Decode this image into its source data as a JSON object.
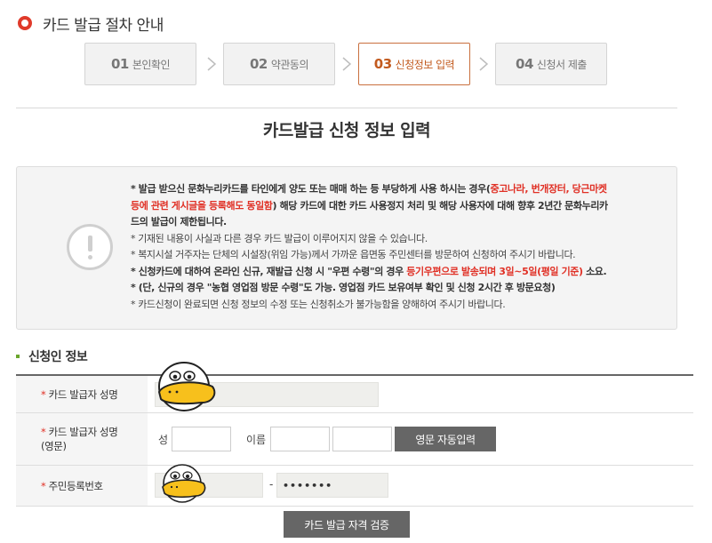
{
  "heading": {
    "title": "카드 발급 절차 안내"
  },
  "steps": [
    {
      "num": "01",
      "label": "본인확인",
      "active": false
    },
    {
      "num": "02",
      "label": "약관동의",
      "active": false
    },
    {
      "num": "03",
      "label": "신청정보 입력",
      "active": true
    },
    {
      "num": "04",
      "label": "신청서 제출",
      "active": false
    }
  ],
  "page_title": "카드발급 신청 정보 입력",
  "notice": {
    "line1a": "* 발급 받으신 문화누리카드를 타인에게 양도 또는 매매 하는 등 부당하게 사용 하시는 경우(",
    "line1b": "중고나라, 번개장터, 당근마켓",
    "line2a": "등에 관련 게시글을 등록해도 동일함",
    "line2b": ") 해당 카드에 대한 카드 사용정지 처리 및 해당 사용자에 대해 향후 2년간 문화누리카",
    "line3": "드의 발급이 제한됩니다.",
    "line4": "* 기재된 내용이 사실과 다른 경우 카드 발급이 이루어지지 않을 수 있습니다.",
    "line5": "* 복지시설 거주자는 단체의 시설장(위임 가능)께서 가까운 읍면동 주민센터를 방문하여 신청하여 주시기 바랍니다.",
    "line6a": "* 신청카드에 대하여 온라인 신규, 재발급 신청 시 \"우편 수령\"의 경우 ",
    "line6b": "등기우편으로 발송되며 3일~5일(평일 기준)",
    "line6c": " 소요.",
    "line7": "* (단, 신규의 경우 \"농협 영업점 방문 수령\"도 가능. 영업점 카드 보유여부 확인 및 신청 2시간 후 방문요청)",
    "line8": "* 카드신청이 완료되면 신청 정보의 수정 또는 신청취소가 불가능함을 양해하여 주시기 바랍니다."
  },
  "section": {
    "title": "신청인 정보"
  },
  "form": {
    "required_mark": "*",
    "name_label": "카드 발급자 성명",
    "eng_label_1": "카드 발급자 성명",
    "eng_label_2": "(영문)",
    "surname_label": "성",
    "given_label": "이름",
    "auto_button": "영문 자동입력",
    "rrn_label": "주민등록번호",
    "rrn_separator": "-",
    "rrn_back": "•••••••"
  },
  "verify_button": "카드 발급 자격 검증",
  "colors": {
    "accent_red": "#e03a2a",
    "active_step": "#c25a1e",
    "green_marker": "#6aa62c",
    "button_gray": "#666666"
  },
  "icons": [
    "ring-bullet-icon",
    "chevron-right-icon",
    "exclamation-circle-icon",
    "duck-sticker-icon"
  ]
}
